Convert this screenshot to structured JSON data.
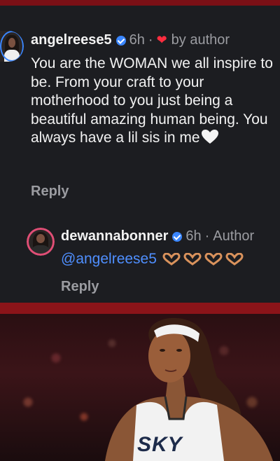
{
  "comment1": {
    "username": "angelreese5",
    "time": "6h",
    "separator": "·",
    "author_like": "by author",
    "text": "You are the WOMAN we all inspire to be. From your craft to your motherhood to you just being a beautiful amazing human being. You always have a lil sis in me",
    "reply_label": "Reply"
  },
  "comment2": {
    "username": "dewannabonner",
    "time": "6h",
    "separator": "·",
    "author_tag": "Author",
    "mention": "@angelreese5",
    "reply_label": "Reply"
  },
  "photo": {
    "jersey_text": "SKY"
  },
  "colors": {
    "background": "#1c1d21",
    "accent_red": "#8b1419",
    "verified_blue": "#3a86ff",
    "mention_blue": "#4f8fff",
    "muted_text": "#9b9ca1",
    "heart_red": "#ff2d3f"
  },
  "icons": {
    "verified": "verified-badge-icon",
    "liked": "red-heart-icon",
    "emoji": "white-heart-icon",
    "hands": "heart-hands-icon"
  }
}
